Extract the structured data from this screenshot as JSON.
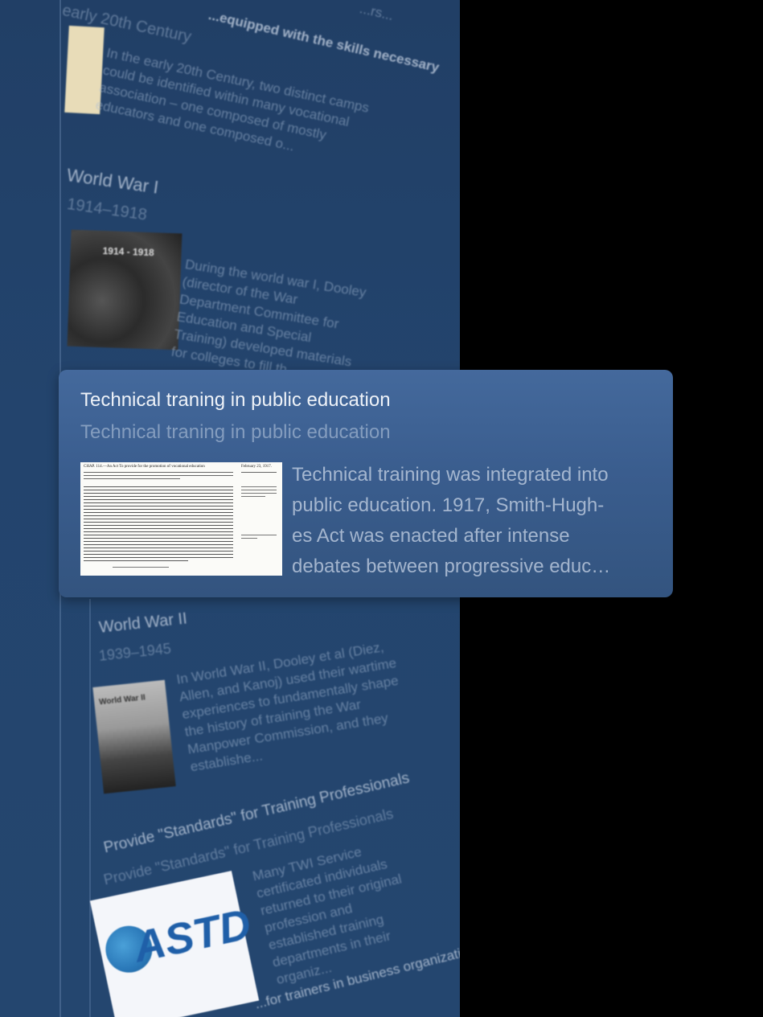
{
  "timeline": {
    "top_fragment": "...equipped with the skills necessary",
    "top_fragment_ellipsis": "...rs...",
    "early_20th": {
      "subtitle": "early 20th Century",
      "text": "In the early 20th Century, two distinct camps could be identified within many vocational association – one composed of mostly educators and one composed o..."
    },
    "ww1": {
      "title": "World War I",
      "years": "1914–1918",
      "photo_caption": "1914 - 1918",
      "text": "During the world war I, Dooley (director of the War Department Committee for Education and Special Training) developed materials for colleges to fill th..."
    },
    "ww2": {
      "title": "World War II",
      "years": "1939–1945",
      "photo_caption": "World War II",
      "text": "In World War II, Dooley et al (Diez, Allen, and Kanoj) used their wartime experiences to fundamentally shape the history of training the War Manpower Commission, and they establishe..."
    },
    "standards": {
      "title": "Provide \"Standards\" for Training Professionals",
      "subtitle": "Provide \"Standards\" for Training Professionals",
      "logo_text": "ASTD",
      "text": "Many TWI Service certificated individuals returned to their original profession and established training departments in their organiz..."
    },
    "bottom_fragment": "...for trainers in business organizations"
  },
  "card": {
    "title": "Technical traning in public education",
    "subtitle": "Technical traning in public education",
    "text_lines": [
      "Technical training was integrated into",
      "public education. 1917, Smith-Hugh-",
      "es Act was enacted after intense",
      "debates between progressive educ…"
    ],
    "doc_header": "CHAP. 114.—An Act To provide for the promotion of vocational education",
    "doc_date": "February 23, 1917."
  },
  "colors": {
    "panel": "#23446d",
    "card": "#3a5d8e",
    "background": "#000000"
  }
}
